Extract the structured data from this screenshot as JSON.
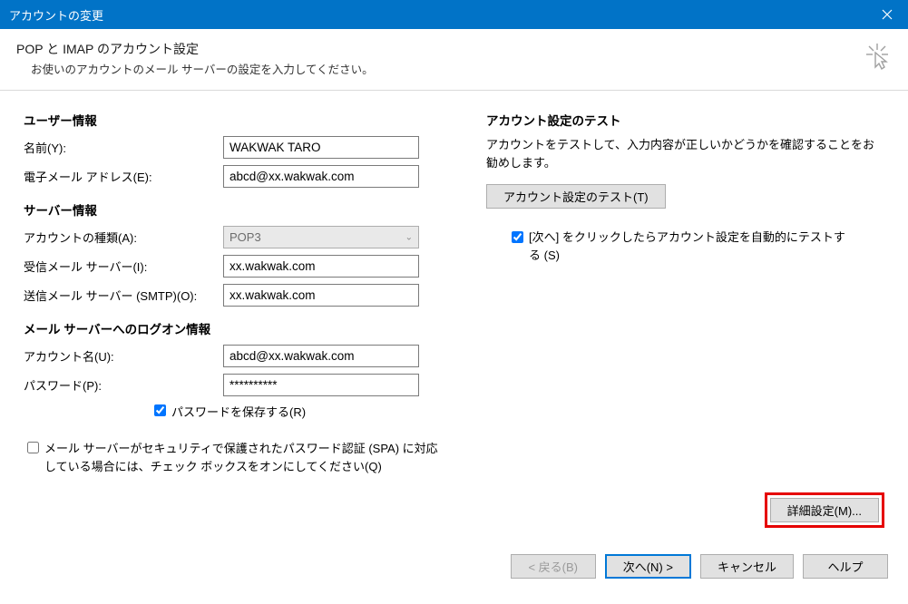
{
  "window": {
    "title": "アカウントの変更"
  },
  "header": {
    "title": "POP と IMAP のアカウント設定",
    "subtitle": "お使いのアカウントのメール サーバーの設定を入力してください。"
  },
  "left": {
    "user_info_heading": "ユーザー情報",
    "name_label": "名前(Y):",
    "name_value": "WAKWAK TARO",
    "email_label": "電子メール アドレス(E):",
    "email_value": "abcd@xx.wakwak.com",
    "server_info_heading": "サーバー情報",
    "account_type_label": "アカウントの種類(A):",
    "account_type_value": "POP3",
    "incoming_label": "受信メール サーバー(I):",
    "incoming_value": "xx.wakwak.com",
    "outgoing_label": "送信メール サーバー (SMTP)(O):",
    "outgoing_value": "xx.wakwak.com",
    "logon_heading": "メール サーバーへのログオン情報",
    "account_name_label": "アカウント名(U):",
    "account_name_value": "abcd@xx.wakwak.com",
    "password_label": "パスワード(P):",
    "password_value": "**********",
    "save_password_label": "パスワードを保存する(R)",
    "save_password_checked": true,
    "spa_label": "メール サーバーがセキュリティで保護されたパスワード認証 (SPA) に対応している場合には、チェック ボックスをオンにしてください(Q)",
    "spa_checked": false
  },
  "right": {
    "test_heading": "アカウント設定のテスト",
    "test_desc": "アカウントをテストして、入力内容が正しいかどうかを確認することをお勧めします。",
    "test_button": "アカウント設定のテスト(T)",
    "auto_test_label": "[次へ] をクリックしたらアカウント設定を自動的にテストする (S)",
    "auto_test_checked": true,
    "advanced_button": "詳細設定(M)..."
  },
  "footer": {
    "back": "< 戻る(B)",
    "next": "次へ(N) >",
    "cancel": "キャンセル",
    "help": "ヘルプ"
  }
}
